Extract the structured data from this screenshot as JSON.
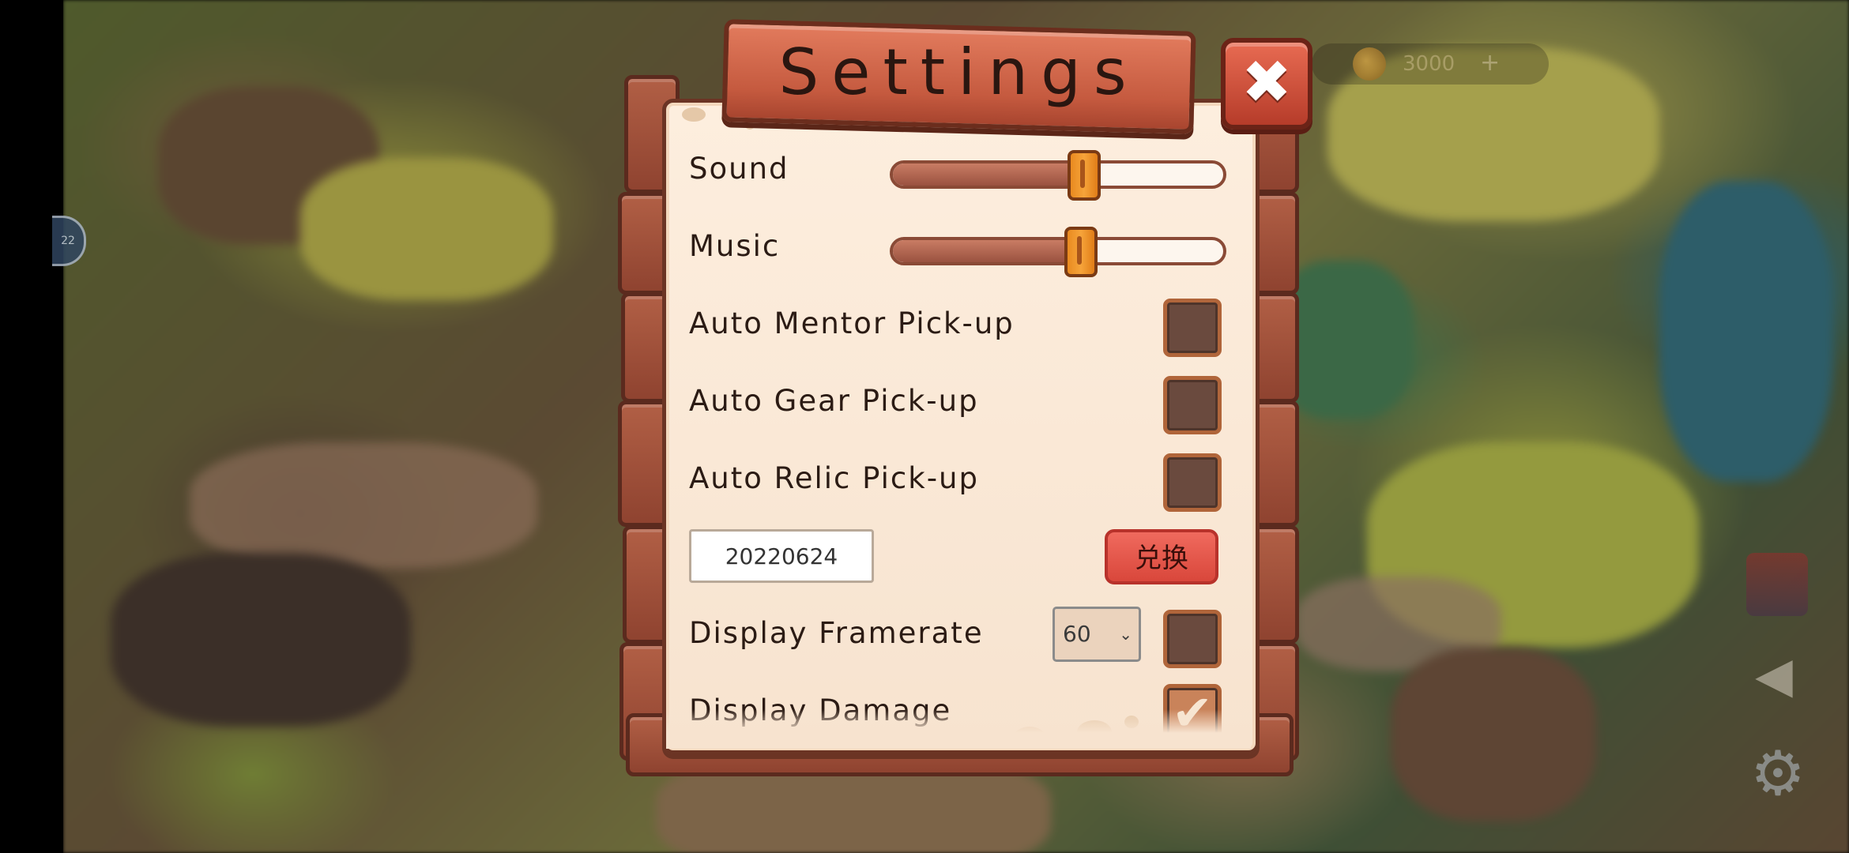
{
  "hud": {
    "side_badge": "22",
    "currency_value": "3000",
    "currency_plus": "+"
  },
  "settings": {
    "title": "Settings",
    "close_icon": "✖",
    "sound": {
      "label": "Sound",
      "level": 0.58
    },
    "music": {
      "label": "Music",
      "level": 0.57
    },
    "auto_mentor": {
      "label": "Auto Mentor Pick-up",
      "checked": false
    },
    "auto_gear": {
      "label": "Auto Gear Pick-up",
      "checked": false
    },
    "auto_relic": {
      "label": "Auto Relic Pick-up",
      "checked": false
    },
    "redeem": {
      "code_value": "20220624",
      "button_label": "兑换"
    },
    "framerate": {
      "label": "Display Framerate",
      "selected": "60",
      "checked": false
    },
    "damage": {
      "label": "Display Damage",
      "checked": true,
      "check_glyph": "✔"
    }
  },
  "icons": {
    "close": "close-icon",
    "check": "check-icon",
    "chevron": "chevron-down-icon",
    "gear": "gear-icon",
    "sound": "speaker-icon"
  },
  "colors": {
    "panel_paper": "#fdeede",
    "title_sign": "#d8674b",
    "thumb": "#f39a2e",
    "redeem_button": "#e8544a"
  }
}
